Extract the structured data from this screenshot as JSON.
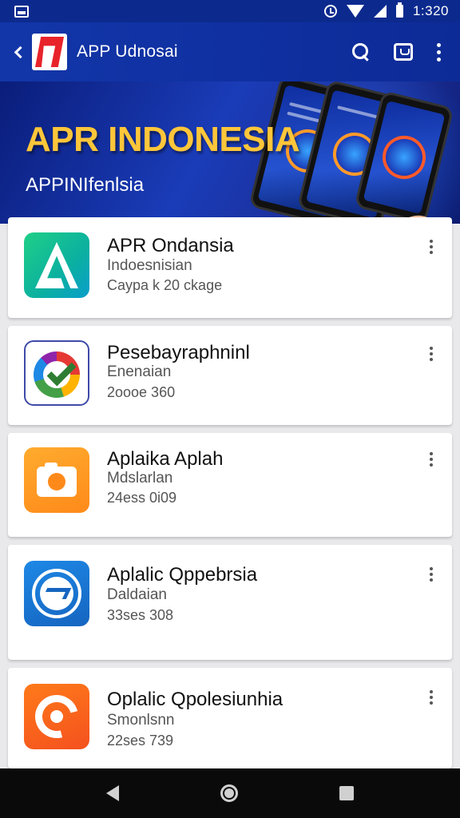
{
  "status_bar": {
    "time": "1:320",
    "icons": [
      "image-icon",
      "alarm-icon",
      "wifi-icon",
      "signal-icon",
      "battery-icon"
    ]
  },
  "app_bar": {
    "title": "APP Udnosai",
    "icons": [
      "back-icon",
      "app-logo",
      "search-icon",
      "store-icon",
      "more-icon"
    ]
  },
  "banner": {
    "title": "APR INDONESIA",
    "subtitle": "APPINIfenlsia"
  },
  "apps": [
    {
      "name": "APR Ondansia",
      "developer": "Indoesnisian",
      "meta": "Caypa k 20 ckage",
      "icon": "green-a-icon"
    },
    {
      "name": "Pesebayraphninl",
      "developer": "Enenaian",
      "meta": "2oooe 360",
      "icon": "color-ring-check-icon"
    },
    {
      "name": "Aplaika Aplah",
      "developer": "Mdslarlan",
      "meta": "24ess 0i09",
      "icon": "camera-icon"
    },
    {
      "name": "Aplalic Qppebrsia",
      "developer": "Daldaian",
      "meta": "33ses 308",
      "icon": "blue-circle-icon"
    },
    {
      "name": "Oplalic Qpolesiunhia",
      "developer": "Smonlsnn",
      "meta": "22ses 739",
      "icon": "orange-swirl-icon"
    }
  ],
  "nav_bar": {
    "icons": [
      "nav-back-icon",
      "nav-home-icon",
      "nav-recent-icon"
    ]
  },
  "colors": {
    "primary": "#1236a8",
    "status_bar": "#0c2a8e",
    "banner_title": "#ffc63a",
    "background": "#e9e9ec"
  }
}
